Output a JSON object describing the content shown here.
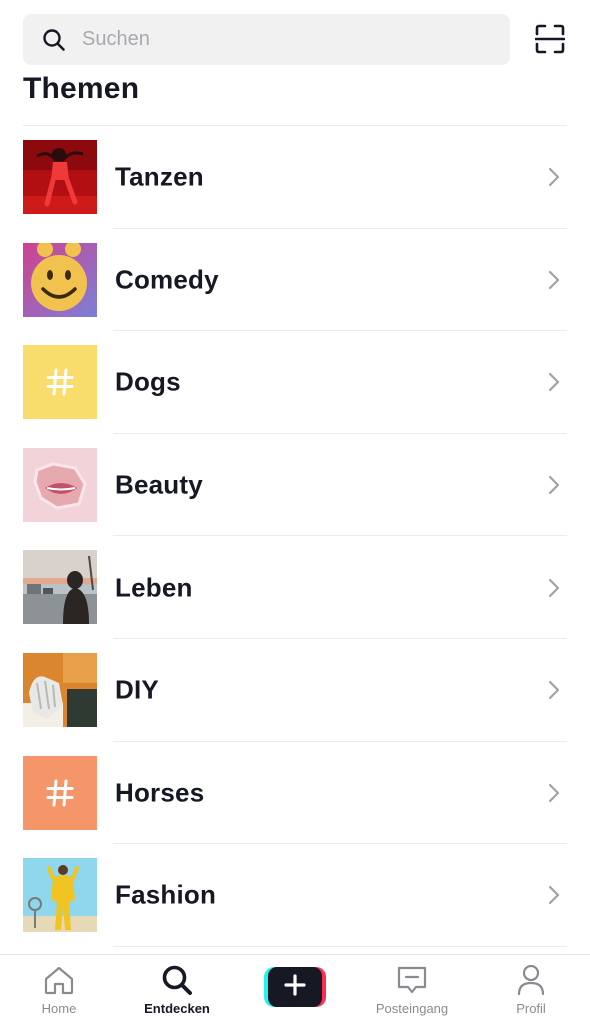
{
  "search": {
    "placeholder": "Suchen",
    "search_icon": "search-icon",
    "scan_icon": "scan-icon"
  },
  "section": {
    "title": "Themen"
  },
  "topics": [
    {
      "label": "Tanzen",
      "thumbnail": "photo-dancer"
    },
    {
      "label": "Comedy",
      "thumbnail": "photo-smiley-balloon"
    },
    {
      "label": "Dogs",
      "thumbnail": "hashtag-icon",
      "thumbnail_color": "#f8dc6c"
    },
    {
      "label": "Beauty",
      "thumbnail": "photo-lips"
    },
    {
      "label": "Leben",
      "thumbnail": "photo-street"
    },
    {
      "label": "DIY",
      "thumbnail": "photo-gloves"
    },
    {
      "label": "Horses",
      "thumbnail": "hashtag-icon",
      "thumbnail_color": "#f4956a"
    },
    {
      "label": "Fashion",
      "thumbnail": "photo-yellow-outfit"
    }
  ],
  "bottom_nav": {
    "home": {
      "label": "Home",
      "icon": "home-icon"
    },
    "discover": {
      "label": "Entdecken",
      "icon": "search-icon",
      "active": true
    },
    "create": {
      "icon": "plus-icon"
    },
    "inbox": {
      "label": "Posteingang",
      "icon": "inbox-icon"
    },
    "profile": {
      "label": "Profil",
      "icon": "person-icon"
    }
  },
  "colors": {
    "text": "#161823",
    "muted": "#8a8b91",
    "search_bg": "#f1f1f2",
    "accent_cyan": "#25f4ee",
    "accent_red": "#fe2c55"
  }
}
